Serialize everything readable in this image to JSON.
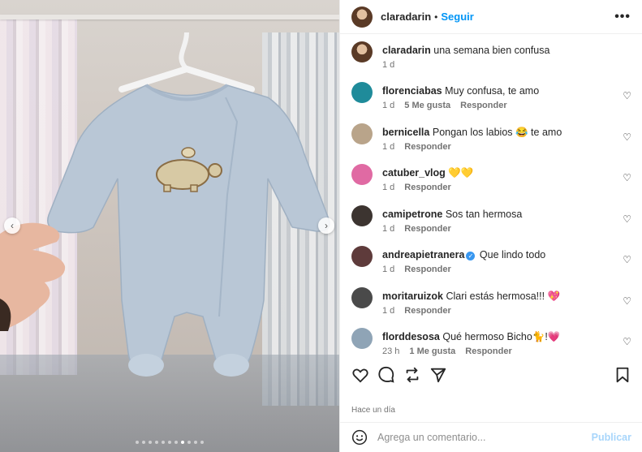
{
  "post": {
    "username": "claradarin",
    "follow_label": "Seguir",
    "more_label": "•••",
    "caption": {
      "username": "claradarin",
      "text": "una semana bien confusa",
      "time": "1 d"
    },
    "time_ago": "Hace un día"
  },
  "media": {
    "dot_count": 11,
    "active_index": 7,
    "prev_label": "‹",
    "next_label": "›"
  },
  "comments": [
    {
      "username": "florenciabas",
      "text": "Muy confusa, te amo",
      "time": "1 d",
      "likes": "5 Me gusta",
      "reply": "Responder",
      "avatar": "#1f8b9a"
    },
    {
      "username": "bernicella",
      "text": "Pongan los labios 😂 te amo",
      "time": "1 d",
      "likes": "",
      "reply": "Responder",
      "avatar": "#b9a48a"
    },
    {
      "username": "catuber_vlog",
      "text": "💛💛",
      "time": "1 d",
      "likes": "",
      "reply": "Responder",
      "avatar": "#e06aa3"
    },
    {
      "username": "camipetrone",
      "text": "Sos tan hermosa",
      "time": "1 d",
      "likes": "",
      "reply": "Responder",
      "avatar": "#3c3430"
    },
    {
      "username": "andreapietranera",
      "text": "Que lindo todo",
      "time": "1 d",
      "likes": "",
      "reply": "Responder",
      "avatar": "#5e3b3b",
      "verified": true
    },
    {
      "username": "moritaruizok",
      "text": "Clari estás hermosa!!! 💖",
      "time": "1 d",
      "likes": "",
      "reply": "Responder",
      "avatar": "#4a4a4a"
    },
    {
      "username": "florddesosa",
      "text": "Qué hermoso Bicho🐈!💗",
      "time": "23 h",
      "likes": "1 Me gusta",
      "reply": "Responder",
      "avatar": "#8fa4b6"
    }
  ],
  "compose": {
    "placeholder": "Agrega un comentario...",
    "publish_label": "Publicar"
  }
}
